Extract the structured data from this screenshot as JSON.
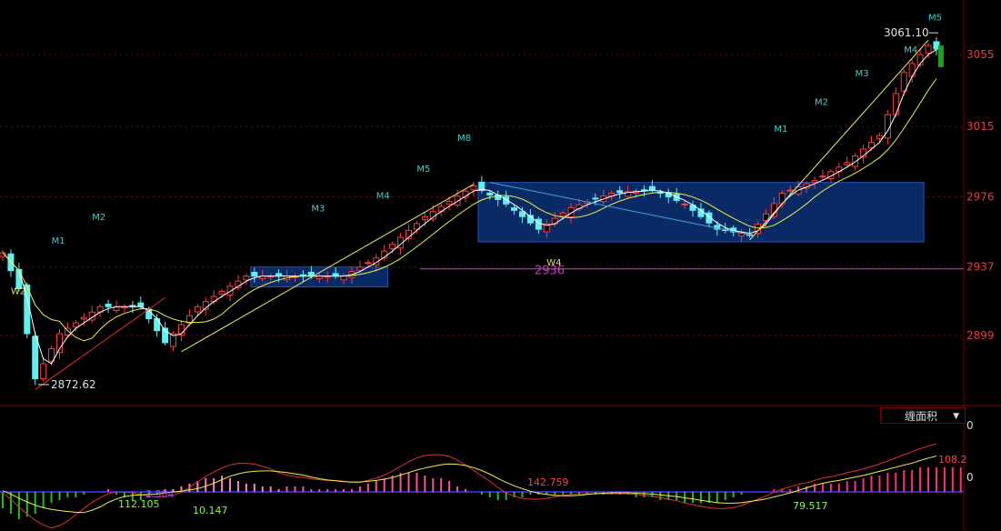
{
  "chart_data": {
    "type": "candlestick",
    "price_axis": {
      "ticks": [
        "3055",
        "3015",
        "2976",
        "2937",
        "2899"
      ],
      "range": [
        2860,
        3080
      ]
    },
    "annotations": {
      "high_value": "3061.10",
      "low_value": "2872.62",
      "support_level_value": 2936,
      "support_level_label": "2936"
    },
    "wave_labels": [
      {
        "text": "W2",
        "price": 2922,
        "bar": 1
      },
      {
        "text": "M1",
        "price": 2950,
        "bar": 6
      },
      {
        "text": "M2",
        "price": 2963,
        "bar": 11
      },
      {
        "text": "M3",
        "price": 2968,
        "bar": 38
      },
      {
        "text": "M4",
        "price": 2975,
        "bar": 46
      },
      {
        "text": "M5",
        "price": 2990,
        "bar": 51
      },
      {
        "text": "M8",
        "price": 3007,
        "bar": 56
      },
      {
        "text": "W4",
        "price": 2938,
        "bar": 67
      },
      {
        "text": "M1",
        "price": 3012,
        "bar": 95
      },
      {
        "text": "M2",
        "price": 3027,
        "bar": 100
      },
      {
        "text": "M3",
        "price": 3043,
        "bar": 105
      },
      {
        "text": "M4",
        "price": 3056,
        "bar": 111
      },
      {
        "text": "M5",
        "price": 3074,
        "bar": 114
      }
    ],
    "consolidation_zones": [
      {
        "bar_start": 31,
        "bar_end": 47,
        "low": 2926,
        "high": 2937
      },
      {
        "bar_start": 59,
        "bar_end": 113,
        "low": 2951,
        "high": 2984
      }
    ],
    "trend_lines": [
      {
        "from": {
          "bar": 4,
          "price": 2869
        },
        "to": {
          "bar": 20,
          "price": 2920
        },
        "color": "#e03030"
      },
      {
        "from": {
          "bar": 22,
          "price": 2890
        },
        "to": {
          "bar": 58,
          "price": 2983
        },
        "color": "#f0f060"
      },
      {
        "from": {
          "bar": 60,
          "price": 2984
        },
        "to": {
          "bar": 92,
          "price": 2955
        },
        "color": "#40a0e0"
      },
      {
        "from": {
          "bar": 92,
          "price": 2952
        },
        "to": {
          "bar": 114,
          "price": 3063
        },
        "color": "#f0f060"
      }
    ],
    "macd": {
      "indicator_name": "缠面积",
      "labels": [
        "2.304",
        "112.105",
        "10.147",
        "142.759",
        "79.517",
        "108.2"
      ],
      "zero_tick": "0",
      "top_tick": "0",
      "histogram": [
        -6,
        -8,
        -10,
        -9,
        -8,
        -6,
        -4,
        -3,
        -2,
        -2,
        -1,
        0,
        0,
        1,
        -1,
        -2,
        -3,
        -3,
        -2,
        -1,
        1,
        1,
        2,
        3,
        4,
        5,
        5,
        6,
        5,
        4,
        3,
        3,
        2,
        2,
        1,
        2,
        2,
        2,
        1,
        1,
        1,
        1,
        1,
        1,
        2,
        3,
        4,
        5,
        6,
        7,
        7,
        7,
        6,
        5,
        5,
        4,
        2,
        1,
        0,
        -1,
        -2,
        -3,
        -3,
        -2,
        -2,
        -1,
        -1,
        -1,
        -1,
        -1,
        -1,
        -1,
        -1,
        -1,
        -1,
        -1,
        -1,
        -1,
        -2,
        -2,
        -2,
        -3,
        -3,
        -3,
        -4,
        -4,
        -4,
        -4,
        -4,
        -3,
        -2,
        -1,
        0,
        0,
        0,
        1,
        1,
        1,
        2,
        2,
        3,
        3,
        3,
        3,
        4,
        4,
        5,
        6,
        6,
        7,
        7,
        8,
        8,
        9,
        9,
        9,
        9,
        9,
        9
      ]
    }
  }
}
